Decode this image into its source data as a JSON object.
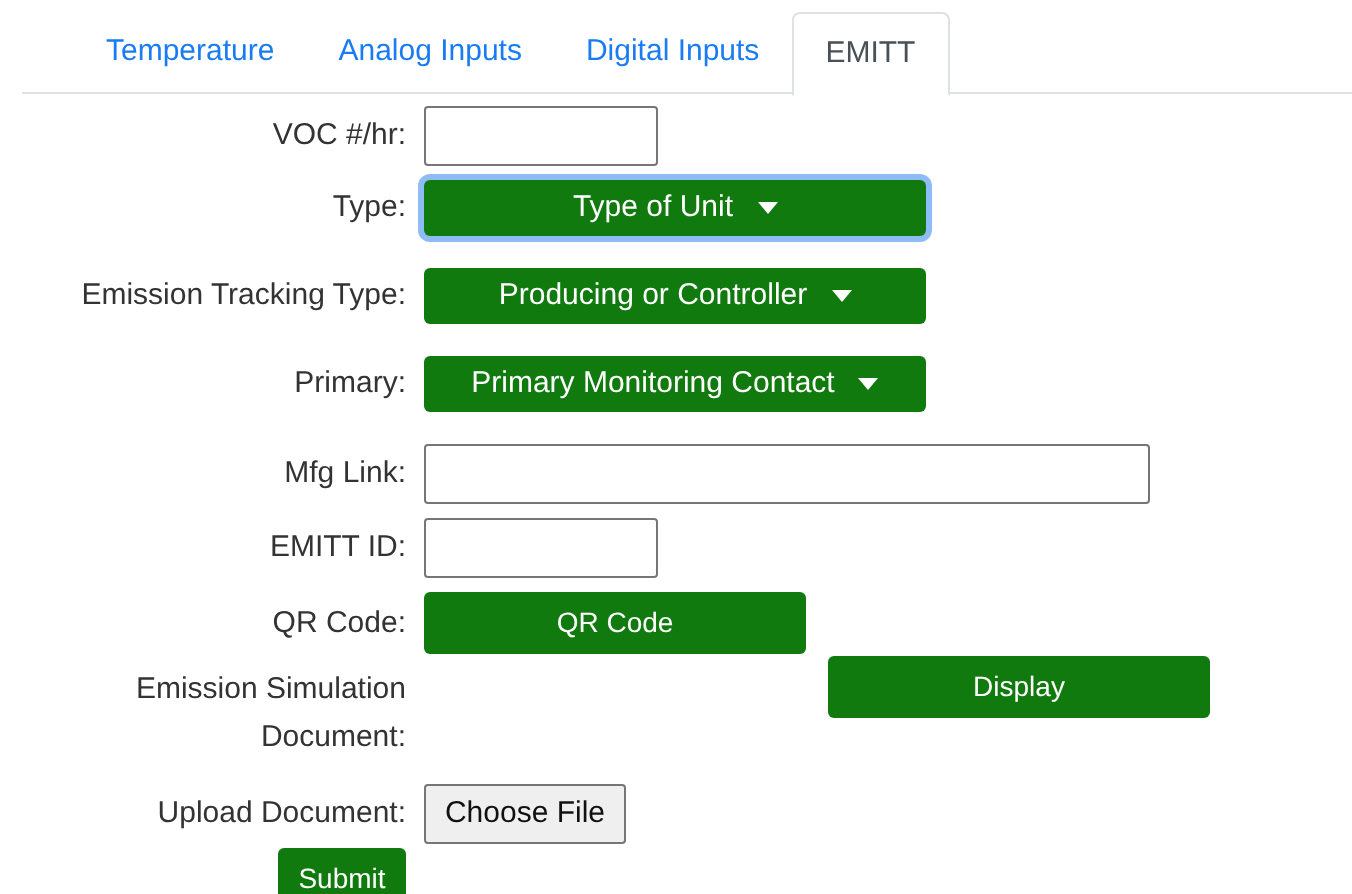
{
  "tabs": [
    {
      "label": "Temperature",
      "selected": false
    },
    {
      "label": "Analog Inputs",
      "selected": false
    },
    {
      "label": "Digital Inputs",
      "selected": false
    },
    {
      "label": "EMITT",
      "selected": true
    }
  ],
  "form": [
    {
      "kind": "input",
      "label": "VOC #/hr:"
    },
    {
      "kind": "dropdown",
      "label": "Type:",
      "value": "Type of Unit",
      "focused": true
    },
    {
      "kind": "dropdown",
      "label": "Emission Tracking Type:",
      "value": "Producing or Controller",
      "focused": false
    },
    {
      "kind": "dropdown",
      "label": "Primary:",
      "value": "Primary Monitoring Contact",
      "focused": false
    },
    {
      "kind": "wide-input",
      "label": "Mfg Link:"
    },
    {
      "kind": "input",
      "label": "EMITT ID:"
    },
    {
      "kind": "button",
      "label": "QR Code:",
      "button": "QR Code"
    },
    {
      "kind": "offset-button",
      "label": "Emission Simulation Document:",
      "button": "Display"
    },
    {
      "kind": "file",
      "label": "Upload Document:",
      "button": "Choose File"
    }
  ],
  "submit": "Submit"
}
